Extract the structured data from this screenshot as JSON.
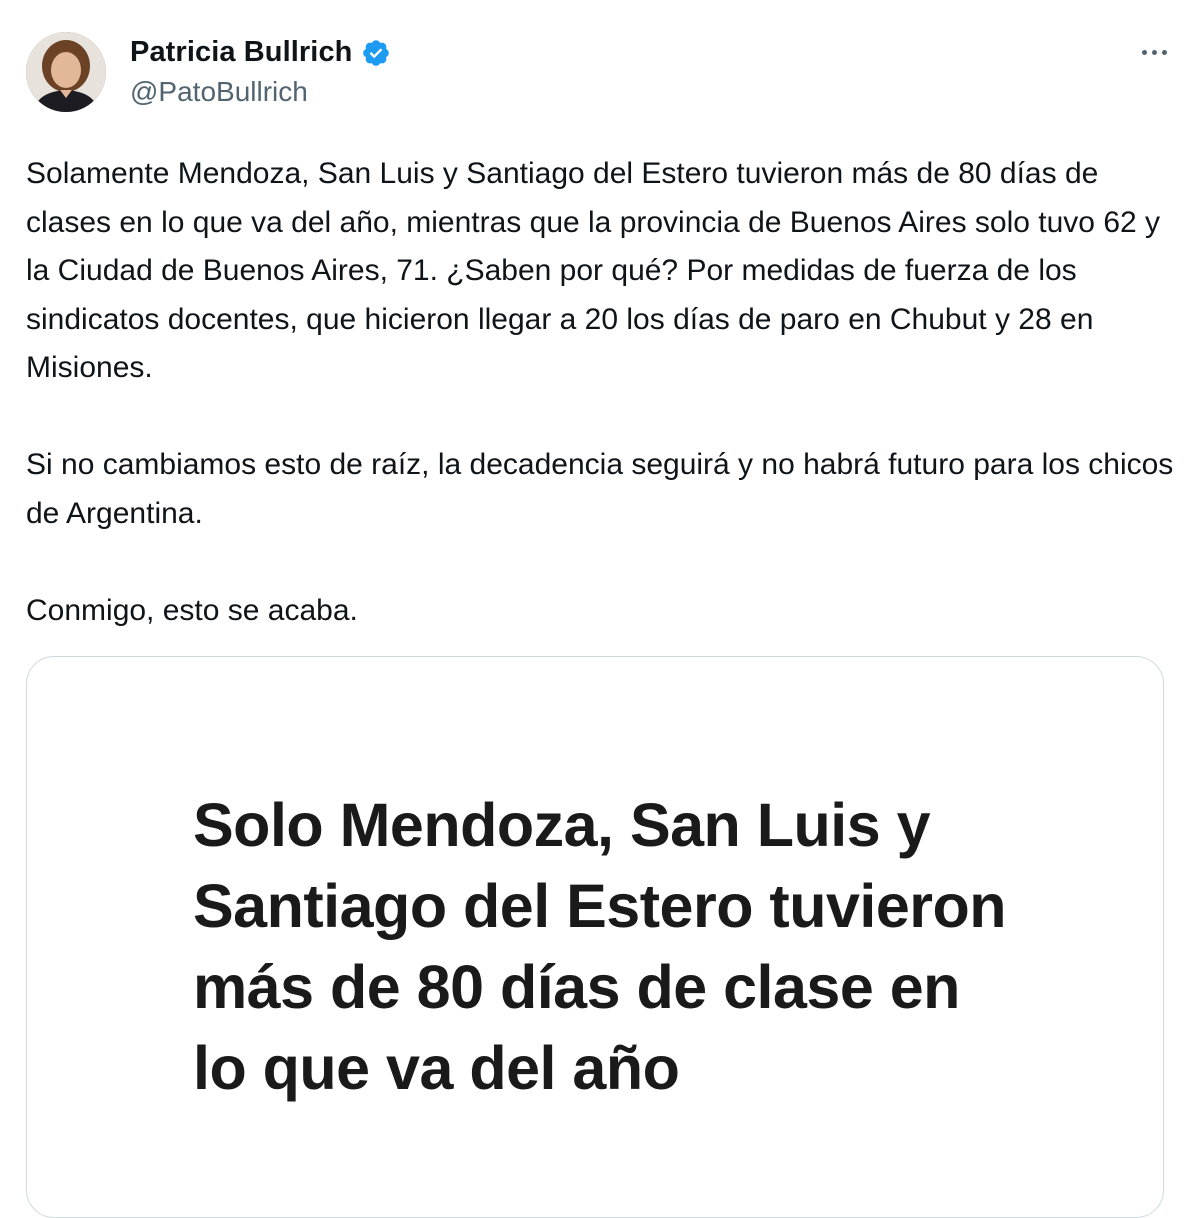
{
  "author": {
    "display_name": "Patricia Bullrich",
    "handle": "@PatoBullrich",
    "verified_color": "#1d9bf0"
  },
  "tweet": {
    "paragraphs": [
      "Solamente Mendoza, San Luis y Santiago del Estero tuvieron más de 80 días de clases en lo que va del año, mientras que la provincia de Buenos Aires solo tuvo 62 y la Ciudad de Buenos Aires, 71. ¿Saben por qué? Por medidas de fuerza de los sindicatos docentes, que hicieron llegar a 20 los días de paro en Chubut y 28 en Misiones.",
      "Si no cambiamos esto de raíz, la decadencia seguirá y no habrá futuro para los chicos de Argentina.",
      "Conmigo, esto se acaba."
    ]
  },
  "card": {
    "headline": "Solo Mendoza, San Luis y Santiago del Estero tuvieron más de 80 días de clase en lo que va del año"
  },
  "icons": {
    "verified": "verified-badge-icon",
    "more": "more-options-icon"
  }
}
